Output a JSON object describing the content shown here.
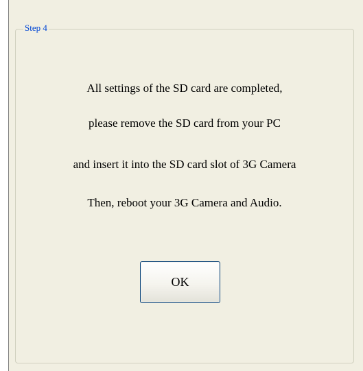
{
  "dialog": {
    "step_label": "Step 4",
    "message_lines": [
      "All settings of the SD card are completed,",
      "please remove the SD card from your PC",
      "and insert it into the SD card slot of 3G Camera",
      "Then, reboot your 3G Camera and Audio."
    ],
    "ok_label": "OK"
  },
  "colors": {
    "panel_background": "#f1efe2",
    "legend_text": "#0046d5",
    "button_border": "#003c74"
  }
}
